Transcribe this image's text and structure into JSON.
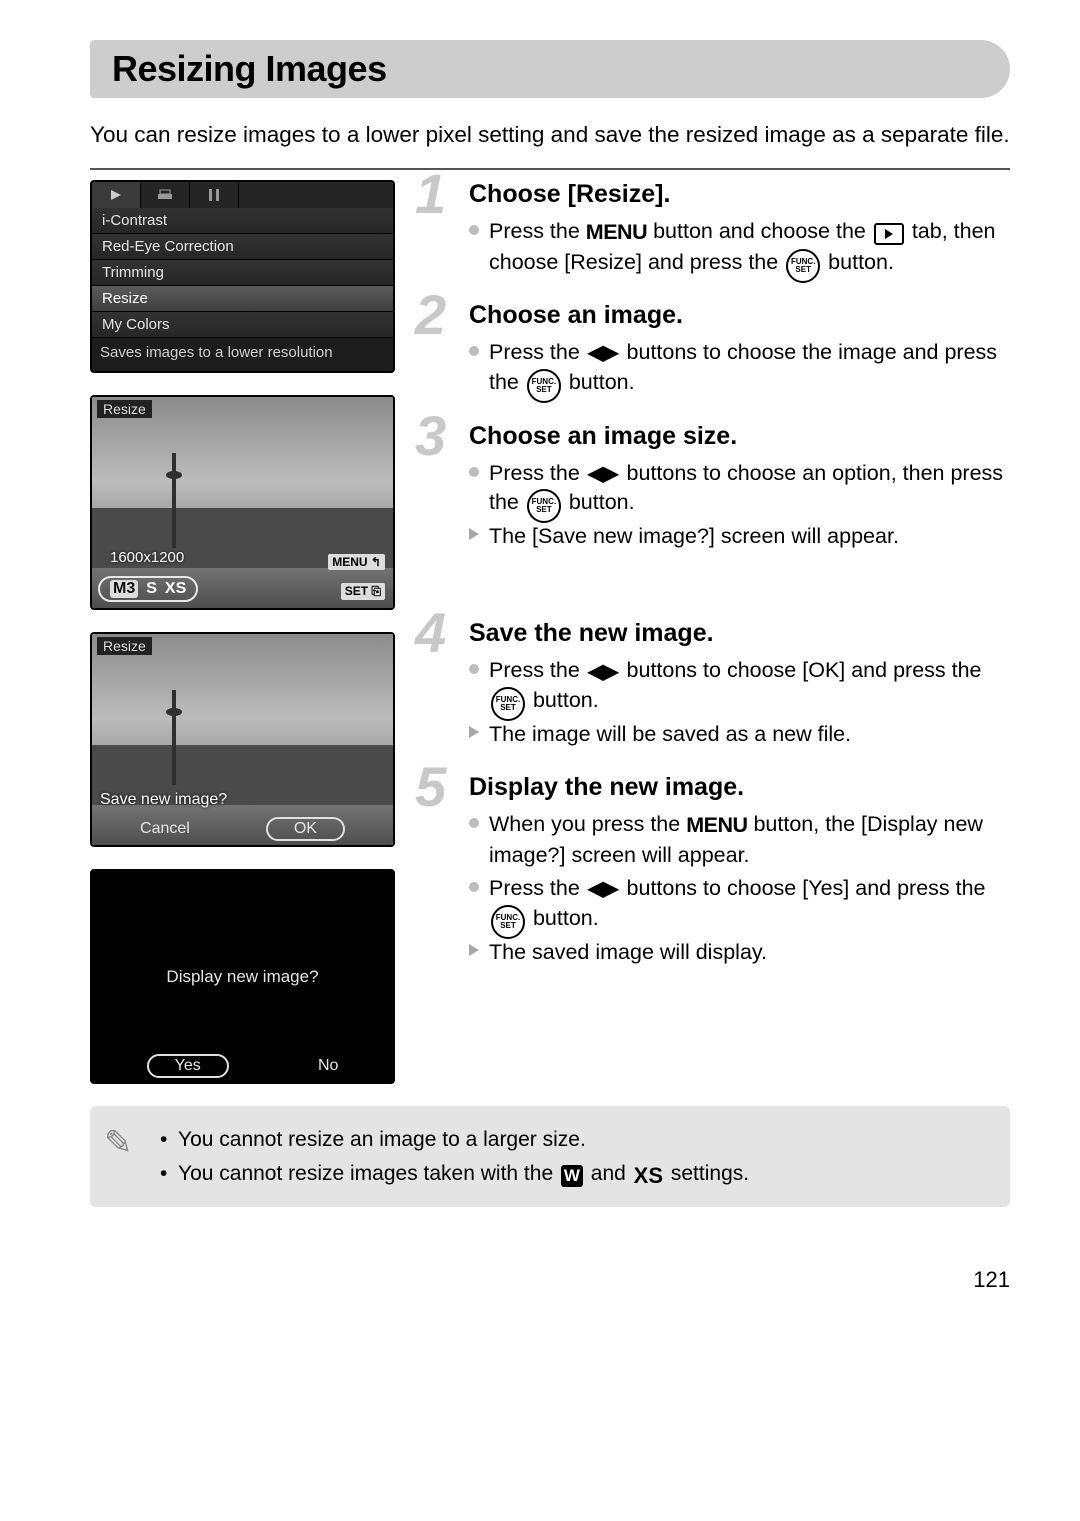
{
  "title": "Resizing Images",
  "intro": "You can resize images to a lower pixel setting and save the resized image as a separate file.",
  "page_number": "121",
  "screens": {
    "menu": {
      "items": [
        "i-Contrast",
        "Red-Eye Correction",
        "Trimming",
        "Resize",
        "My Colors"
      ],
      "selected_index": 3,
      "hint": "Saves images to a lower resolution"
    },
    "size_select": {
      "corner": "Resize",
      "resolution": "1600x1200",
      "menu_badge": "MENU ↰",
      "set_badge": "SET ⎘",
      "options": [
        "M3",
        "S",
        "XS"
      ]
    },
    "save_prompt": {
      "corner": "Resize",
      "prompt": "Save new image?",
      "cancel": "Cancel",
      "ok": "OK"
    },
    "display_prompt": {
      "prompt": "Display new image?",
      "yes": "Yes",
      "no": "No"
    }
  },
  "steps": [
    {
      "title": "Choose [Resize].",
      "body": [
        {
          "t": "dot",
          "pre": "Press the ",
          "post1": " button and choose the ",
          "post2": " tab, then choose [Resize] and press the ",
          "post3": " button.",
          "kind": "step1"
        }
      ]
    },
    {
      "title": "Choose an image.",
      "body": [
        {
          "t": "dot",
          "pre": "Press the ",
          "mid": " buttons to choose the image and press the ",
          "post": " button.",
          "kind": "lrfunc"
        }
      ]
    },
    {
      "title": "Choose an image size.",
      "body": [
        {
          "t": "dot",
          "pre": "Press the ",
          "mid": " buttons to choose an option, then press the ",
          "post": " button.",
          "kind": "lrfunc"
        },
        {
          "t": "tri",
          "text": "The [Save new image?] screen will appear."
        }
      ]
    },
    {
      "title": "Save the new image.",
      "body": [
        {
          "t": "dot",
          "pre": "Press the ",
          "mid": " buttons to choose [OK] and press the ",
          "post": " button.",
          "kind": "lrfunc"
        },
        {
          "t": "tri",
          "text": "The image will be saved as a new file."
        }
      ]
    },
    {
      "title": "Display the new image.",
      "body": [
        {
          "t": "dot",
          "pre": "When you press the ",
          "post": " button, the [Display new image?] screen will appear.",
          "kind": "menu"
        },
        {
          "t": "dot",
          "pre": "Press the ",
          "mid": " buttons to choose [Yes] and press the ",
          "post": " button.",
          "kind": "lrfunc"
        },
        {
          "t": "tri",
          "text": "The saved image will display."
        }
      ]
    }
  ],
  "notes": {
    "line1": "You cannot resize an image to a larger size.",
    "line2_pre": "You cannot resize images taken with the ",
    "line2_mid": " and ",
    "line2_post": " settings."
  },
  "glyphs": {
    "menu_word": "MENU",
    "func_top": "FUNC.",
    "func_bot": "SET",
    "xs": "XS",
    "w": "W"
  }
}
